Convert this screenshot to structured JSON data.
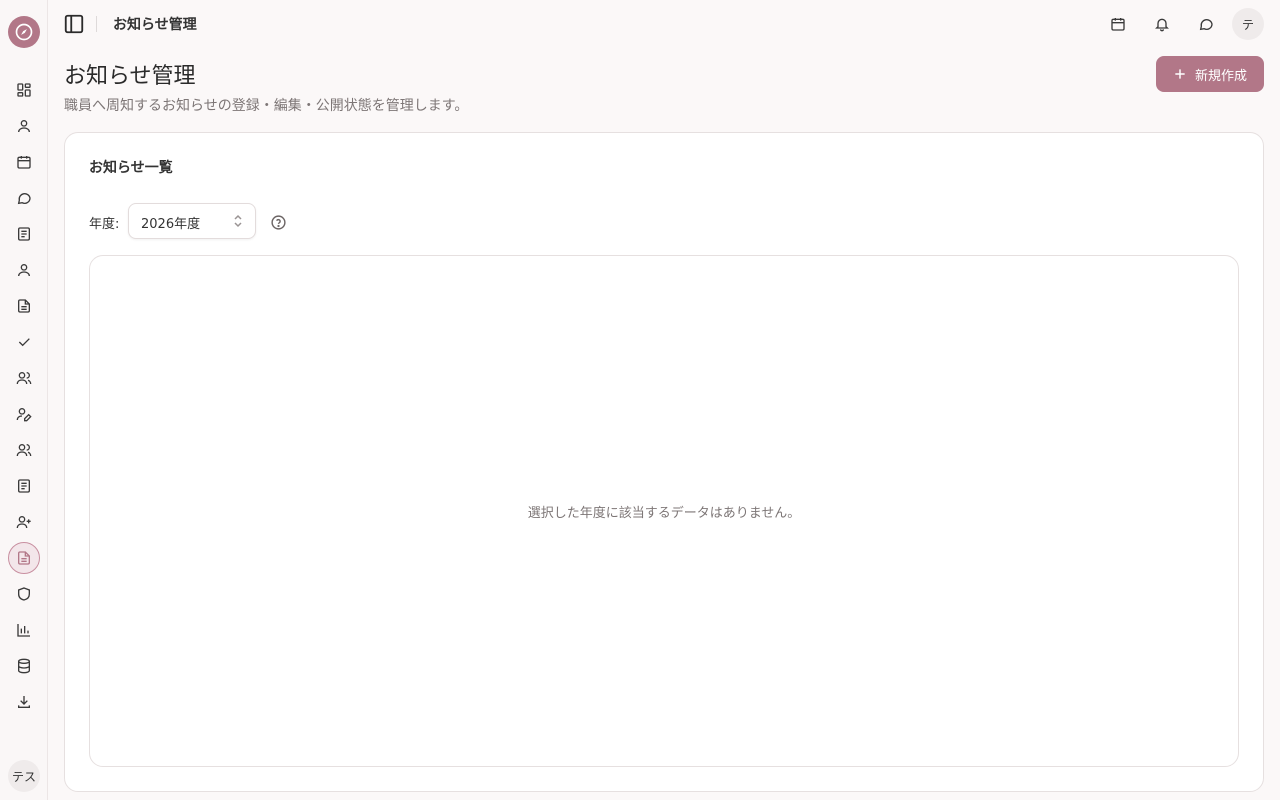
{
  "header": {
    "breadcrumb": "お知らせ管理",
    "avatar": "テ"
  },
  "sidebar": {
    "user": "テス",
    "items": [
      {
        "icon": "dashboard-icon"
      },
      {
        "icon": "user-icon"
      },
      {
        "icon": "calendar-icon"
      },
      {
        "icon": "chat-icon"
      },
      {
        "icon": "book-icon"
      },
      {
        "icon": "person-icon"
      },
      {
        "icon": "document-icon"
      },
      {
        "icon": "check-icon"
      },
      {
        "icon": "users-icon"
      },
      {
        "icon": "user-edit-icon"
      },
      {
        "icon": "users-group-icon"
      },
      {
        "icon": "notebook-icon"
      },
      {
        "icon": "user-plus-icon"
      },
      {
        "icon": "notice-document-icon",
        "active": true
      },
      {
        "icon": "shield-icon"
      },
      {
        "icon": "bar-chart-icon"
      },
      {
        "icon": "database-icon"
      },
      {
        "icon": "download-icon"
      }
    ]
  },
  "page": {
    "title": "お知らせ管理",
    "description": "職員へ周知するお知らせの登録・編集・公開状態を管理します。",
    "new_button": "新規作成"
  },
  "card": {
    "title": "お知らせ一覧",
    "year_label": "年度:",
    "year_value": "2026年度",
    "empty_message": "選択した年度に該当するデータはありません。"
  },
  "colors": {
    "accent": "#b27788",
    "background": "#fbf8f8"
  }
}
